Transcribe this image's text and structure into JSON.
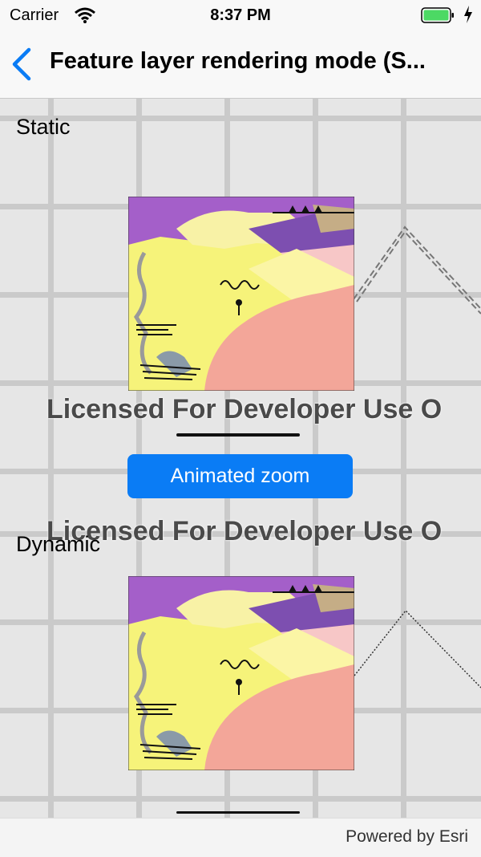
{
  "status_bar": {
    "carrier": "Carrier",
    "time": "8:37 PM",
    "wifi_icon": "wifi-icon",
    "battery_icon": "battery-icon",
    "charging_icon": "bolt-icon",
    "battery_color": "#4cd964"
  },
  "nav": {
    "title": "Feature layer rendering mode (S...",
    "back_icon": "chevron-left-icon",
    "accent": "#0a7cf5"
  },
  "static_map": {
    "label": "Static",
    "watermark": "Licensed For Developer Use O"
  },
  "dynamic_map": {
    "label": "Dynamic",
    "watermark": "Licensed For Developer Use O"
  },
  "zoom_button": {
    "label": "Animated zoom"
  },
  "attribution": {
    "text": "Powered by Esri"
  }
}
